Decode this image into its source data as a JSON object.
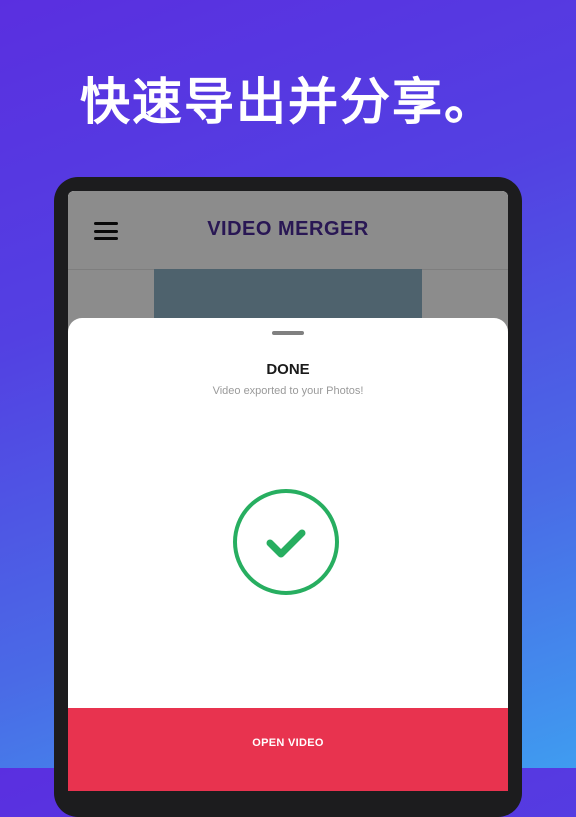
{
  "headline": "快速导出并分享。",
  "app": {
    "title": "VIDEO MERGER",
    "menu_icon": "hamburger-menu-icon"
  },
  "sheet": {
    "title": "DONE",
    "subtitle": "Video exported to your Photos!",
    "status_icon": "check-circle-icon",
    "button_label": "OPEN VIDEO"
  },
  "colors": {
    "background_top": "#5a2fe0",
    "background_bottom": "#3f9cf0",
    "app_title": "#4b2a9a",
    "success_green": "#27ae60",
    "button_red": "#e8334f"
  }
}
